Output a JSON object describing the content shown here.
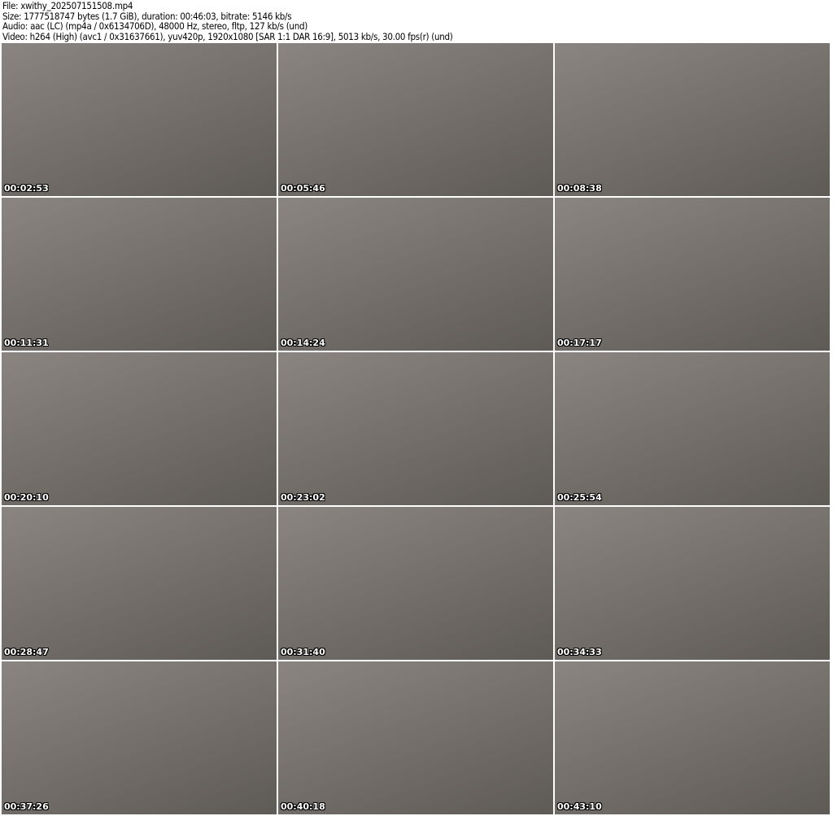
{
  "header": {
    "file": "File: xwithy_202507151508.mp4",
    "size": "Size: 1777518747 bytes (1.7 GiB), duration: 00:46:03, bitrate: 5146 kb/s",
    "audio": "Audio: aac (LC) (mp4a / 0x6134706D), 48000 Hz, stereo, fltp, 127 kb/s (und)",
    "video": "Video: h264 (High) (avc1 / 0x31637661), yuv420p, 1920x1080 [SAR 1:1 DAR 16:9], 5013 kb/s, 30.00 fps(r) (und)"
  },
  "thumbnails": [
    {
      "timestamp": "00:02:53"
    },
    {
      "timestamp": "00:05:46"
    },
    {
      "timestamp": "00:08:38"
    },
    {
      "timestamp": "00:11:31"
    },
    {
      "timestamp": "00:14:24"
    },
    {
      "timestamp": "00:17:17"
    },
    {
      "timestamp": "00:20:10"
    },
    {
      "timestamp": "00:23:02"
    },
    {
      "timestamp": "00:25:54"
    },
    {
      "timestamp": "00:28:47"
    },
    {
      "timestamp": "00:31:40"
    },
    {
      "timestamp": "00:34:33"
    },
    {
      "timestamp": "00:37:26"
    },
    {
      "timestamp": "00:40:18"
    },
    {
      "timestamp": "00:43:10"
    }
  ]
}
